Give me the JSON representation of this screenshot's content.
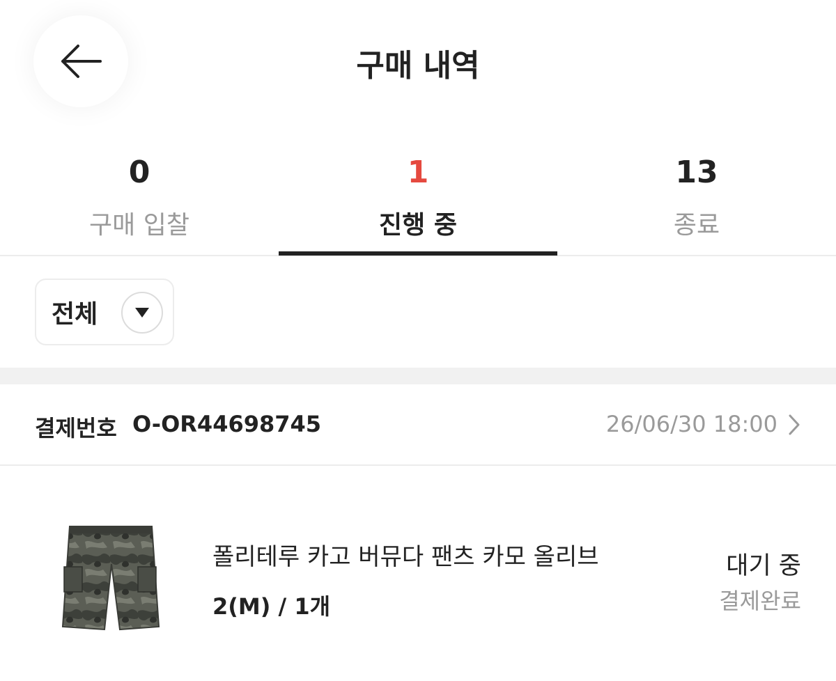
{
  "header": {
    "title": "구매 내역",
    "back_icon": "arrow-left-icon"
  },
  "tabs": [
    {
      "count": "0",
      "label": "구매 입찰",
      "active": false
    },
    {
      "count": "1",
      "label": "진행 중",
      "active": true
    },
    {
      "count": "13",
      "label": "종료",
      "active": false
    }
  ],
  "filter": {
    "label": "전체",
    "icon": "caret-down-icon"
  },
  "order": {
    "number_label": "결제번호",
    "number": "O-OR44698745",
    "date": "26/06/30 18:00",
    "chevron_icon": "chevron-right-icon",
    "item": {
      "name": "폴리테루 카고 버뮤다 팬츠 카모 올리브",
      "option": "2(M) / 1개",
      "status": "대기 중",
      "substatus": "결제완료",
      "thumbnail": "camo-cargo-shorts-image"
    }
  },
  "colors": {
    "accent_count": "#e5493f",
    "text_primary": "#222222",
    "text_secondary": "#9a9a9a",
    "divider": "#ececec",
    "band": "#f1f1f1"
  }
}
